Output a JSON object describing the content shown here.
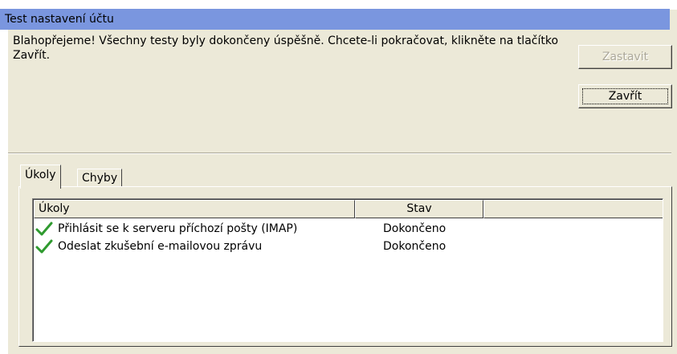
{
  "window": {
    "title": "Test nastavení účtu"
  },
  "message": "Blahopřejeme! Všechny testy byly dokončeny úspěšně. Chcete-li pokračovat, klikněte na tlačítko Zavřít.",
  "buttons": {
    "stop_label": "Zastavit",
    "close_label": "Zavřít"
  },
  "tabs": [
    {
      "label": "Úkoly",
      "active": true
    },
    {
      "label": "Chyby",
      "active": false
    }
  ],
  "table": {
    "columns": [
      "Úkoly",
      "Stav",
      ""
    ],
    "rows": [
      {
        "icon": "checkmark-icon",
        "task": "Přihlásit se k serveru příchozí pošty (IMAP)",
        "status": "Dokončeno"
      },
      {
        "icon": "checkmark-icon",
        "task": "Odeslat zkušební e-mailovou zprávu",
        "status": "Dokončeno"
      }
    ]
  },
  "colors": {
    "titlebar": "#7a96df",
    "dialog_bg": "#ece9d8",
    "check": "#2f9a2f"
  }
}
